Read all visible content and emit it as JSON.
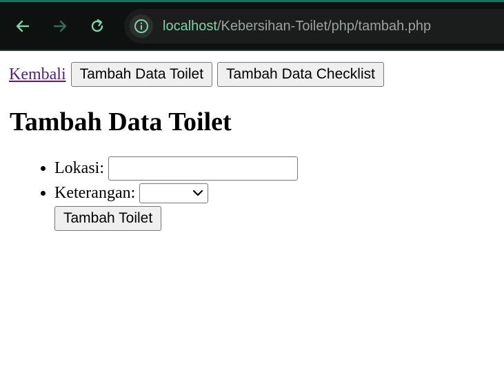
{
  "browser": {
    "url_host": "localhost",
    "url_path": "/Kebersihan-Toilet/php/tambah.php",
    "icons": {
      "back": "arrow-left-icon",
      "forward": "arrow-right-icon",
      "reload": "reload-icon",
      "site_info": "info-icon"
    },
    "accent_color": "#7fd3a6"
  },
  "nav": {
    "back_link": "Kembali",
    "btn_toilet": "Tambah Data Toilet",
    "btn_checklist": "Tambah Data Checklist"
  },
  "page": {
    "title": "Tambah Data Toilet"
  },
  "form": {
    "lokasi_label": "Lokasi:",
    "lokasi_value": "",
    "keterangan_label": "Keterangan:",
    "keterangan_selected": "",
    "submit_label": "Tambah Toilet"
  }
}
